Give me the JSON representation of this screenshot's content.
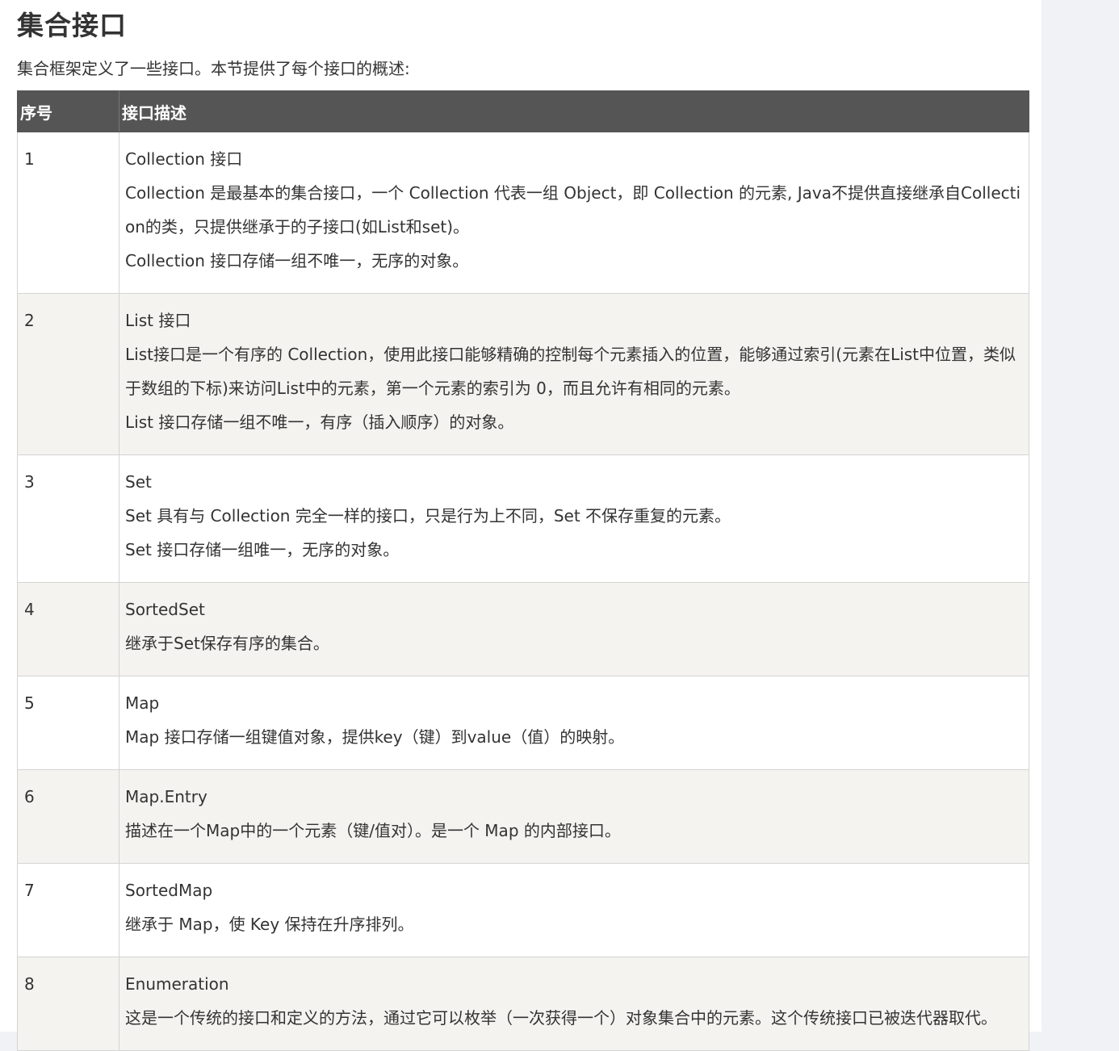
{
  "page_title": "集合接口",
  "intro": "集合框架定义了一些接口。本节提供了每个接口的概述:",
  "table": {
    "headers": [
      "序号",
      "接口描述"
    ],
    "rows": [
      {
        "num": "1",
        "name": "Collection 接口",
        "lines": [
          "Collection 是最基本的集合接口，一个 Collection 代表一组 Object，即 Collection 的元素, Java不提供直接继承自Collection的类，只提供继承于的子接口(如List和set)。",
          "Collection 接口存储一组不唯一，无序的对象。"
        ]
      },
      {
        "num": "2",
        "name": "List 接口",
        "lines": [
          "List接口是一个有序的 Collection，使用此接口能够精确的控制每个元素插入的位置，能够通过索引(元素在List中位置，类似于数组的下标)来访问List中的元素，第一个元素的索引为 0，而且允许有相同的元素。",
          "List 接口存储一组不唯一，有序（插入顺序）的对象。"
        ]
      },
      {
        "num": "3",
        "name": "Set",
        "lines": [
          "Set 具有与 Collection 完全一样的接口，只是行为上不同，Set 不保存重复的元素。",
          "Set 接口存储一组唯一，无序的对象。"
        ]
      },
      {
        "num": "4",
        "name": "SortedSet",
        "lines": [
          "继承于Set保存有序的集合。"
        ]
      },
      {
        "num": "5",
        "name": "Map",
        "lines": [
          "Map 接口存储一组键值对象，提供key（键）到value（值）的映射。"
        ]
      },
      {
        "num": "6",
        "name": "Map.Entry",
        "lines": [
          "描述在一个Map中的一个元素（键/值对）。是一个 Map 的内部接口。"
        ]
      },
      {
        "num": "7",
        "name": "SortedMap",
        "lines": [
          "继承于 Map，使 Key 保持在升序排列。"
        ]
      },
      {
        "num": "8",
        "name": "Enumeration",
        "lines": [
          "这是一个传统的接口和定义的方法，通过它可以枚举（一次获得一个）对象集合中的元素。这个传统接口已被迭代器取代。"
        ]
      }
    ]
  }
}
